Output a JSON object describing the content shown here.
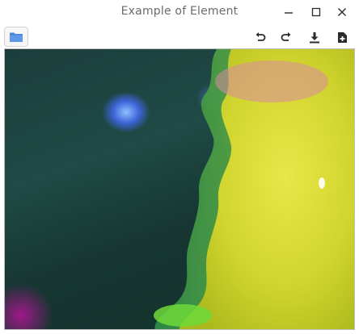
{
  "window": {
    "title": "Example of Element",
    "controls": [
      "minimize",
      "maximize",
      "close"
    ]
  },
  "toolbar": {
    "open_icon": "folder-icon",
    "tools": [
      "undo-icon",
      "redo-icon",
      "download-icon",
      "add-file-icon"
    ]
  },
  "colors": {
    "accent_blue": "#4a86d8",
    "icon_dark": "#2b2b2b",
    "title_text": "#6b6b6b"
  }
}
